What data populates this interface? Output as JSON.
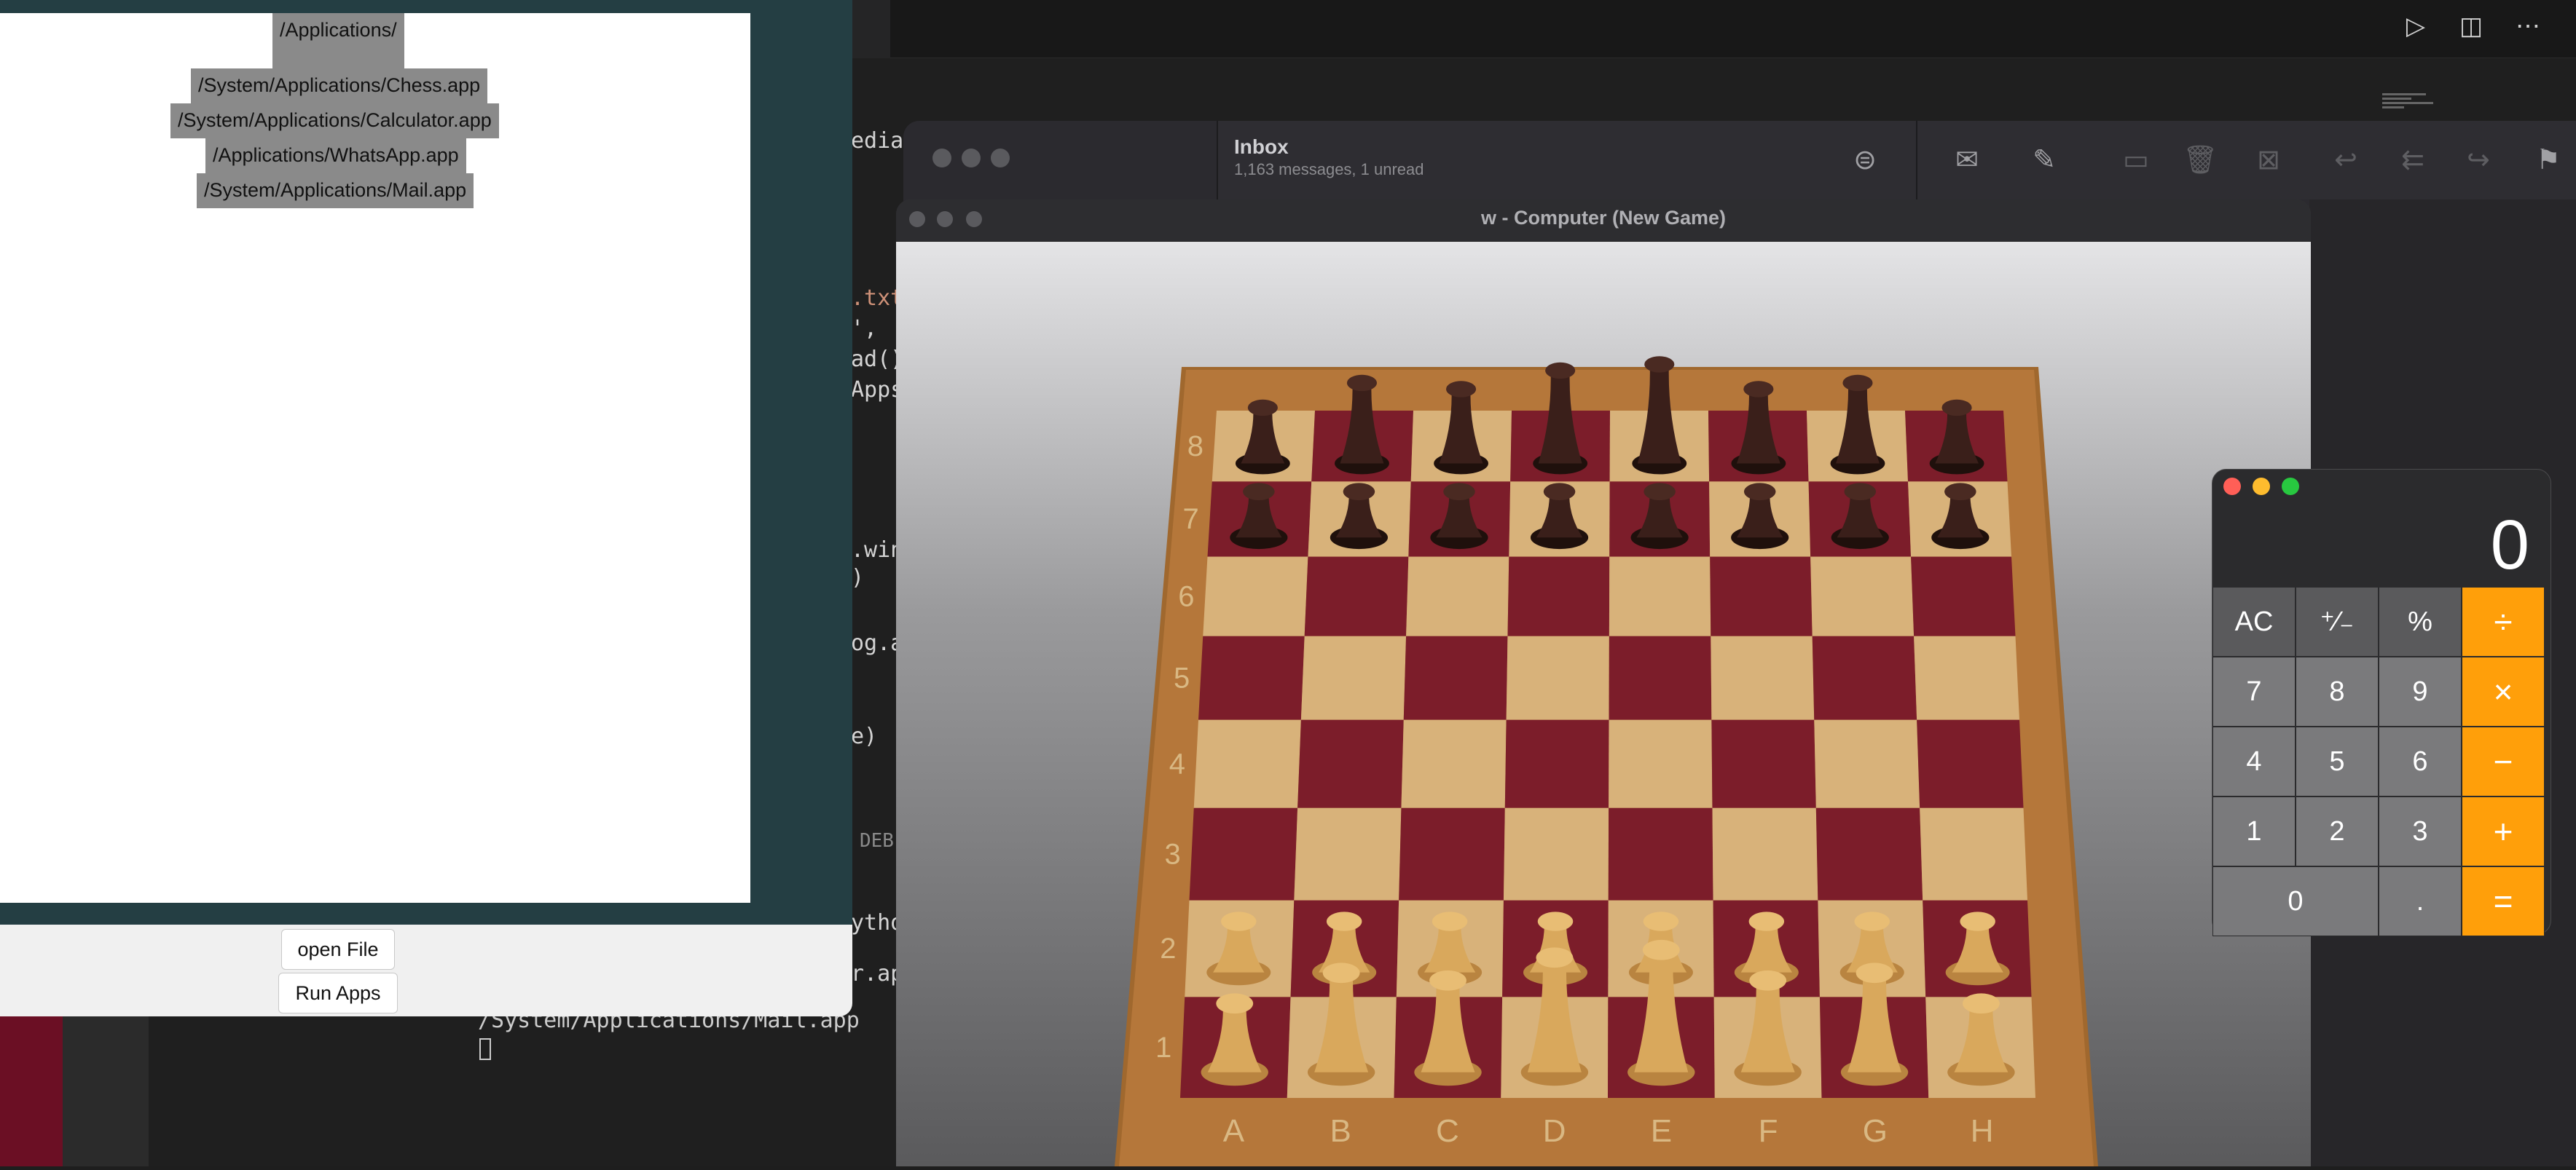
{
  "vscode": {
    "code_fragments": [
      "edia",
      ".txt",
      "', ",
      "ad()",
      "Apps",
      ".win",
      ")",
      "og.a",
      "e)",
      "DEB",
      "ytho",
      "r.ap"
    ],
    "terminal_lines": [
      "/System/Applications/Mail.app"
    ],
    "top_icons": [
      "play-icon",
      "split-editor-icon",
      "more-icon"
    ]
  },
  "python_app": {
    "list_items": [
      "/Applications/",
      "/System/Applications/Chess.app",
      "/System/Applications/Calculator.app",
      "/Applications/WhatsApp.app",
      "/System/Applications/Mail.app"
    ],
    "open_file_label": "open File",
    "run_apps_label": "Run Apps"
  },
  "mail": {
    "mailbox": "Inbox",
    "summary": "1,163 messages, 1 unread",
    "toolbar_icons": [
      "filter-icon",
      "get-mail-icon",
      "compose-icon",
      "archive-icon",
      "trash-icon",
      "junk-icon",
      "reply-icon",
      "reply-all-icon",
      "forward-icon",
      "flag-icon"
    ]
  },
  "chess": {
    "title": "w - Computer   (New Game)",
    "files": [
      "A",
      "B",
      "C",
      "D",
      "E",
      "F",
      "G",
      "H"
    ],
    "ranks": [
      "8",
      "7",
      "6",
      "5",
      "4",
      "3",
      "2",
      "1"
    ],
    "back_rank": [
      "rook",
      "knight",
      "bishop",
      "queen",
      "king",
      "bishop",
      "knight",
      "rook"
    ],
    "colors": {
      "dark_square": "#7c1d2a",
      "light_square": "#d8b27a",
      "frame": "#a0682e",
      "white_piece": "#d9a85c",
      "black_piece": "#3a1f1a"
    }
  },
  "calculator": {
    "display": "0",
    "keys": [
      [
        "AC",
        "⁺∕₋",
        "%",
        "÷"
      ],
      [
        "7",
        "8",
        "9",
        "×"
      ],
      [
        "4",
        "5",
        "6",
        "−"
      ],
      [
        "1",
        "2",
        "3",
        "+"
      ],
      [
        "0",
        ".",
        "="
      ]
    ],
    "colors": {
      "operator": "#ff9f0a",
      "function": "#5a5a5c",
      "number": "#7a7a7c"
    }
  }
}
